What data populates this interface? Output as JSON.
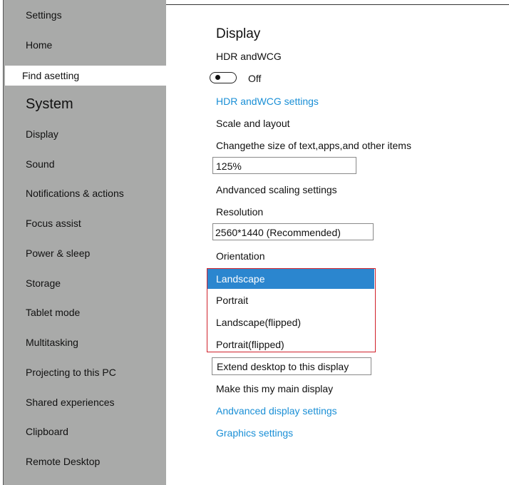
{
  "sidebar": {
    "settings_label": "Settings",
    "home_label": "Home",
    "search_placeholder": "Find asetting",
    "section_title": "System",
    "items": [
      "Display",
      "Sound",
      "Notifications & actions",
      "Focus assist",
      "Power & sleep",
      "Storage",
      "Tablet mode",
      "Multitasking",
      "Projecting to this PC",
      "Shared experiences",
      "Clipboard",
      "Remote Desktop"
    ]
  },
  "main": {
    "title": "Display",
    "hdr_heading": "HDR andWCG",
    "hdr_toggle_state": "Off",
    "hdr_link": "HDR andWCG settings",
    "scale_heading": "Scale and layout",
    "scale_desc": "Changethe size of text,apps,and other items",
    "scale_value": "125%",
    "advanced_scaling": "Andvanced scaling settings",
    "resolution_heading": "Resolution",
    "resolution_value": "2560*1440 (Recommended)",
    "orientation_heading": "Orientation",
    "orientation_options": [
      "Landscape",
      "Portrait",
      "Landscape(flipped)",
      "Portrait(flipped)"
    ],
    "multiple_displays_value": "Extend desktop to this display",
    "main_display": "Make this my main display",
    "advanced_display_link": "Andvanced display settings",
    "graphics_link": "Graphics settings"
  },
  "colors": {
    "sidebar_bg": "#a9aaa9",
    "link": "#1a8fd6",
    "selected": "#2b86cf",
    "dropdown_border": "#d0202a"
  }
}
